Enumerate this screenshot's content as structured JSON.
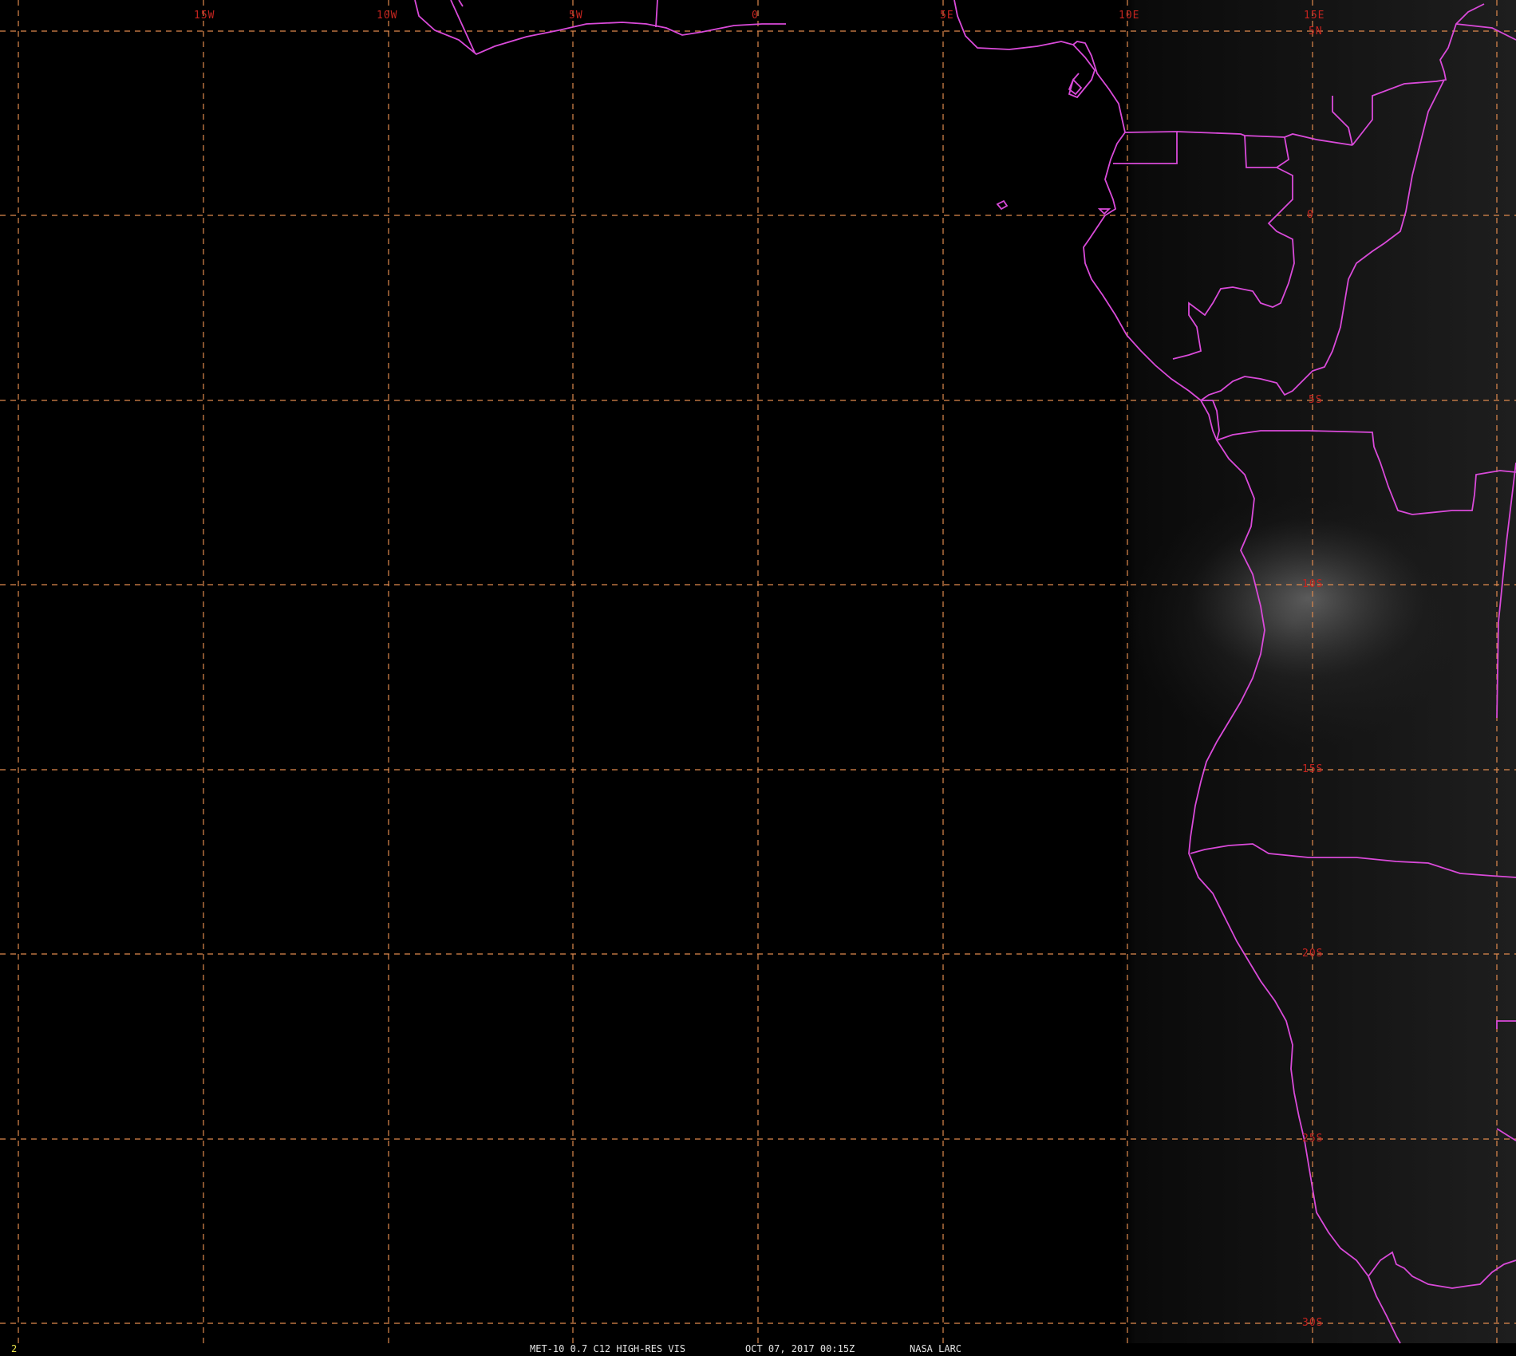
{
  "map": {
    "longitude_labels": [
      "15W",
      "10W",
      "5W",
      "0",
      "5E",
      "10E",
      "15E"
    ],
    "latitude_labels": [
      "5N",
      "0",
      "5S",
      "10S",
      "15S",
      "20S",
      "25S",
      "30S"
    ],
    "colors": {
      "background": "#000000",
      "grid": "#e08a4e",
      "borders": "#d94ad9",
      "labels": "#c4241f",
      "frame_number": "#e8e24a",
      "caption": "#e2e2e2"
    },
    "icons": [
      "coastline-outline",
      "country-border-outline"
    ]
  },
  "caption": {
    "frame": "2",
    "product": "MET-10 0.7 C12 HIGH-RES VIS",
    "time": "OCT 07, 2017 00:15Z",
    "source": "NASA LARC"
  }
}
